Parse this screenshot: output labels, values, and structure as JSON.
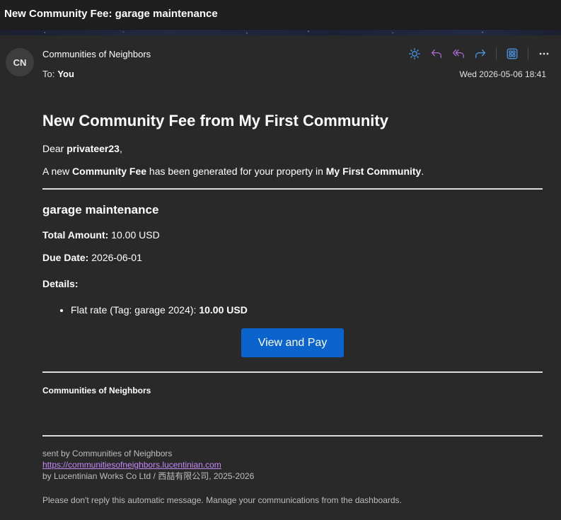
{
  "window": {
    "title": "New Community Fee: garage maintenance"
  },
  "header": {
    "avatar_initials": "CN",
    "sender": "Communities of Neighbors",
    "to_label": "To:",
    "to_value": "You",
    "date": "Wed 2026-05-06 18:41"
  },
  "toolbar": {
    "icons": [
      "sun-icon",
      "reply-icon",
      "reply-all-icon",
      "forward-icon",
      "apps-icon",
      "more-icon"
    ],
    "colors": {
      "sun": "#4d9cf0",
      "reply": "#b36fd9",
      "reply_all": "#b36fd9",
      "forward": "#4d9cf0",
      "apps": "#4d9cf0",
      "more": "#e0e0e0"
    }
  },
  "email": {
    "heading": "New Community Fee from My First Community",
    "greeting_prefix": "Dear ",
    "user_name": "privateer23",
    "greeting_suffix": ",",
    "intro_1": "A new ",
    "intro_fee": "Community Fee",
    "intro_2": " has been generated for your property in ",
    "intro_community": "My First Community",
    "intro_3": ".",
    "fee_title": "garage maintenance",
    "total_label": "Total Amount:",
    "total_value": "10.00 USD",
    "due_label": "Due Date:",
    "due_value": "2026-06-01",
    "details_label": "Details:",
    "details_items": [
      {
        "text": "Flat rate (Tag: garage 2024): ",
        "amount": "10.00 USD"
      }
    ],
    "pay_button": "View and Pay",
    "footer_name": "Communities of Neighbors",
    "sent_by": "sent by Communities of Neighbors",
    "link": "https://communitiesofneighbors.lucentinian.com",
    "company": "by Lucentinian Works Co Ltd / 西喆有限公司, 2025-2026",
    "noreply": "Please don't reply this automatic message. Manage your communications from the dashboards."
  },
  "colors": {
    "background": "#292929",
    "button": "#0b63ce",
    "link": "#c58af9"
  }
}
